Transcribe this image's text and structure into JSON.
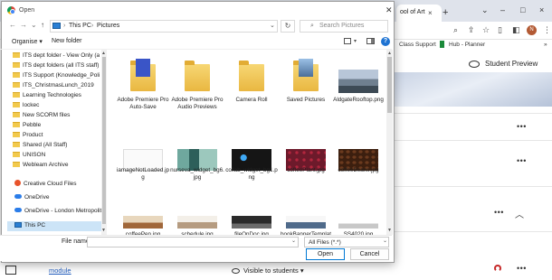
{
  "background": {
    "tab_title": "ool of Art",
    "bookmarks": [
      "Class Support",
      "Hub - Planner"
    ],
    "student_preview": "Student Preview",
    "module_link": "module",
    "visible_label": "Visible to students",
    "visible_caret": "▾",
    "more_dots": "•••",
    "chevron": "︿",
    "newtab": "+",
    "close_x": "×",
    "win_min": "–",
    "win_max": "□",
    "win_close": "×",
    "win_chevron": "⌄",
    "avatar_letter": "N"
  },
  "dialog": {
    "title": "Open",
    "close": "✕",
    "breadcrumbs": [
      "This PC",
      "Pictures"
    ],
    "crumb_sep": "›",
    "search_placeholder": "Search Pictures",
    "organise": "Organise ▾",
    "new_folder": "New folder",
    "help": "?",
    "nav_back": "←",
    "nav_forward": "→",
    "nav_recent": "⌄",
    "nav_up": "↑",
    "refresh": "↻",
    "addr_drop": "⌄",
    "nav_items": [
      {
        "label": "ITS dept folder - View Only (all I",
        "icon": "folder-icon"
      },
      {
        "label": "ITS dept folders (all ITS staff)",
        "icon": "folder-icon"
      },
      {
        "label": "ITS Support (Knowledge_Policie",
        "icon": "folder-icon"
      },
      {
        "label": "ITS_ChristmasLunch_2019",
        "icon": "folder-icon"
      },
      {
        "label": "Learning Technologies",
        "icon": "folder-icon"
      },
      {
        "label": "lockec",
        "icon": "folder-icon"
      },
      {
        "label": "New SCORM files",
        "icon": "folder-icon"
      },
      {
        "label": "Pebble",
        "icon": "folder-icon"
      },
      {
        "label": "Product",
        "icon": "folder-icon"
      },
      {
        "label": "Shared (All Staff)",
        "icon": "folder-icon"
      },
      {
        "label": "UNISON",
        "icon": "folder-icon"
      },
      {
        "label": "Webleam Archive",
        "icon": "folder-icon"
      },
      {
        "label": "Creative Cloud Files",
        "icon": "creative-cloud-icon"
      },
      {
        "label": "OneDrive",
        "icon": "onedrive-icon"
      },
      {
        "label": "OneDrive - London Metropolitan",
        "icon": "onedrive-icon"
      },
      {
        "label": "This PC",
        "icon": "this-pc-icon"
      }
    ],
    "files": [
      {
        "name": "Adobe Premiere Pro Auto-Save",
        "thumb": "premiere-folder"
      },
      {
        "name": "Adobe Premiere Pro Audio Previews",
        "thumb": "folder"
      },
      {
        "name": "Camera Roll",
        "thumb": "folder"
      },
      {
        "name": "Saved Pictures",
        "thumb": "saved-folder"
      },
      {
        "name": "AldgateRooftop.png",
        "thumb": "rooftop"
      },
      {
        "name": "iamageNotLoaded.jpg",
        "thumb": "blank"
      },
      {
        "name": "nurseva_widget_bg6.jpg",
        "thumb": "nurse"
      },
      {
        "name": "collab_widget_bg1.png",
        "thumb": "collab"
      },
      {
        "name": "coffeePlant.jpg",
        "thumb": "coffeeplant"
      },
      {
        "name": "coffeeBeans.jpg",
        "thumb": "beans"
      },
      {
        "name": "coffeePen.jpg",
        "thumb": "pen"
      },
      {
        "name": "schedule.jpg",
        "thumb": "schedule"
      },
      {
        "name": "fileOnDoc.jpg",
        "thumb": "filedoc"
      },
      {
        "name": "bookBannerTemplate.jpg",
        "thumb": "book"
      },
      {
        "name": "SS4020.jpg",
        "thumb": "ss"
      }
    ],
    "file_name_label": "File name:",
    "file_name_value": "",
    "filter": "All Files (*.*)",
    "open": "Open",
    "cancel": "Cancel",
    "drop_caret": "⌄"
  },
  "colors": {
    "accent": "#0078d4",
    "selection": "#cce4f7",
    "folder": "#f2c94c"
  }
}
